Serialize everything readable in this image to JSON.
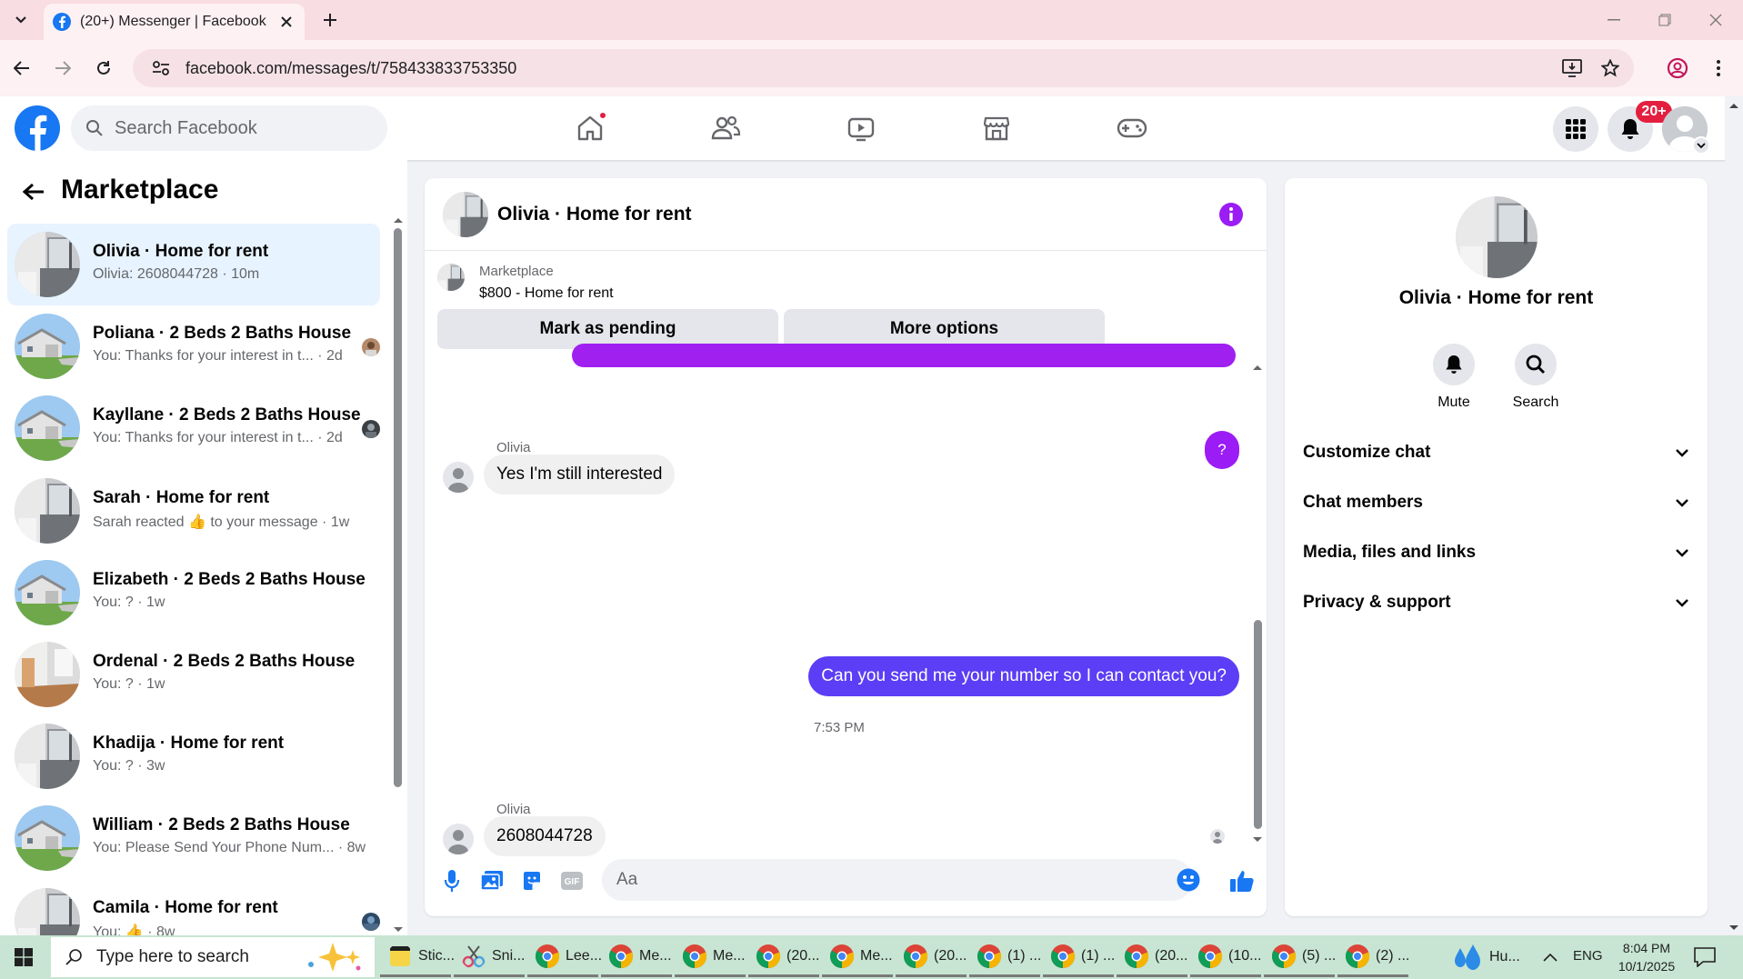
{
  "browser": {
    "tab_title": "(20+) Messenger | Facebook",
    "url": "facebook.com/messages/t/758433833753350"
  },
  "header": {
    "search_placeholder": "Search Facebook",
    "notification_count": "20+"
  },
  "sidebar": {
    "title": "Marketplace",
    "conversations": [
      {
        "name": "Olivia · Home for rent",
        "preview": "Olivia: 2608044728 · 10m",
        "thumb": "bathroom"
      },
      {
        "name": "Poliana · 2 Beds 2 Baths House",
        "preview": "You: Thanks for your interest in t... · 2d",
        "thumb": "house"
      },
      {
        "name": "Kayllane · 2 Beds 2 Baths House",
        "preview": "You: Thanks for your interest in t... · 2d",
        "thumb": "house"
      },
      {
        "name": "Sarah · Home for rent",
        "preview": "Sarah reacted 👍 to your message · 1w",
        "thumb": "bathroom"
      },
      {
        "name": "Elizabeth · 2 Beds 2 Baths House",
        "preview": "You: ? · 1w",
        "thumb": "house"
      },
      {
        "name": "Ordenal · 2 Beds 2 Baths House",
        "preview": "You: ? · 1w",
        "thumb": "room"
      },
      {
        "name": "Khadija · Home for rent",
        "preview": "You: ? · 3w",
        "thumb": "bathroom"
      },
      {
        "name": "William · 2 Beds 2 Baths House",
        "preview": "You: Please Send Your Phone Num... · 8w",
        "thumb": "house"
      },
      {
        "name": "Camila · Home for rent",
        "preview": "You: 👍 · 8w",
        "thumb": "bathroom"
      }
    ]
  },
  "chat": {
    "title": "Olivia · Home for rent",
    "listing_kind": "Marketplace",
    "listing_title": "$800 - Home for rent",
    "mark_pending_label": "Mark as pending",
    "more_options_label": "More options",
    "question_bubble": "?",
    "messages": [
      {
        "sender": "Olivia",
        "text": "Yes I'm still interested"
      },
      {
        "sender": "You",
        "text": "Can you send me your number so I can contact you?"
      },
      {
        "sender": "Olivia",
        "text": "2608044728"
      }
    ],
    "timestamp": "7:53 PM",
    "input_placeholder": "Aa"
  },
  "info_panel": {
    "name": "Olivia · Home for rent",
    "mute_label": "Mute",
    "search_label": "Search",
    "sections": [
      "Customize chat",
      "Chat members",
      "Media, files and links",
      "Privacy & support"
    ]
  },
  "taskbar": {
    "search_placeholder": "Type here to search",
    "apps": [
      {
        "label": "Stic...",
        "icon": "sticky-notes"
      },
      {
        "label": "Sni...",
        "icon": "snipping-tool"
      },
      {
        "label": "Lee...",
        "icon": "chrome"
      },
      {
        "label": "Me...",
        "icon": "chrome"
      },
      {
        "label": "Me...",
        "icon": "chrome"
      },
      {
        "label": "(20...",
        "icon": "chrome"
      },
      {
        "label": "Me...",
        "icon": "chrome"
      },
      {
        "label": "(20...",
        "icon": "chrome"
      },
      {
        "label": "(1) ...",
        "icon": "chrome"
      },
      {
        "label": "(1) ...",
        "icon": "chrome"
      },
      {
        "label": "(20...",
        "icon": "chrome"
      },
      {
        "label": "(10...",
        "icon": "chrome"
      },
      {
        "label": "(5) ...",
        "icon": "chrome"
      },
      {
        "label": "(2) ...",
        "icon": "chrome"
      }
    ],
    "weather_label": "Hu...",
    "language": "ENG",
    "time": "8:04 PM",
    "date": "10/1/2025"
  },
  "colors": {
    "fb_blue": "#1877f2",
    "outgoing_bubble": "#5b3ef5",
    "purple_accent": "#9b1cf5",
    "active_conversation": "#e7f3ff",
    "notification_red": "#e41e3f"
  }
}
